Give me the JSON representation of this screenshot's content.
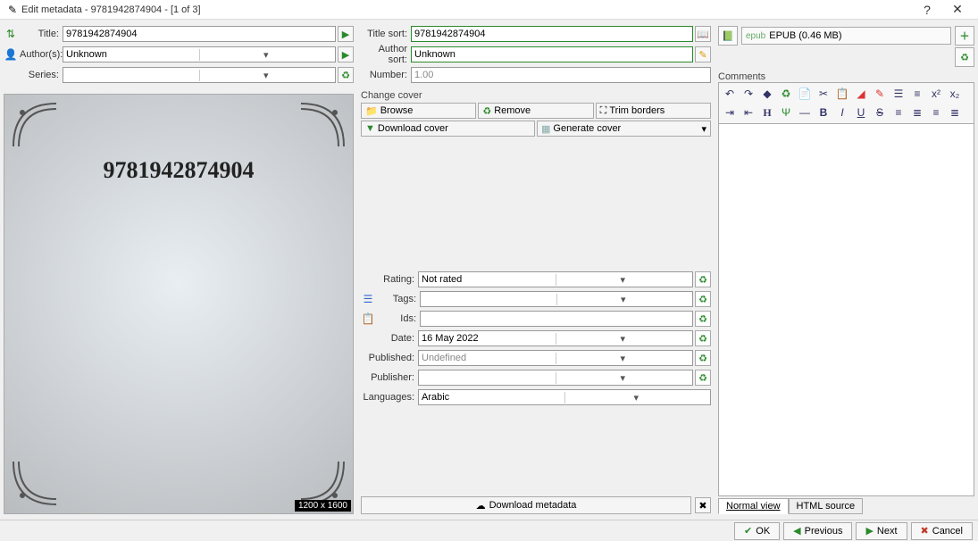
{
  "window": {
    "title": "Edit metadata - 9781942874904 -  [1 of 3]"
  },
  "fields": {
    "title_label": "Title:",
    "title_value": "9781942874904",
    "titlesort_label": "Title sort:",
    "titlesort_value": "9781942874904",
    "authors_label": "Author(s):",
    "authors_value": "Unknown",
    "authorsort_label": "Author sort:",
    "authorsort_value": "Unknown",
    "series_label": "Series:",
    "series_value": "",
    "number_label": "Number:",
    "number_value": "1.00"
  },
  "cover": {
    "section": "Change cover",
    "browse": "Browse",
    "remove": "Remove",
    "trim": "Trim borders",
    "download": "Download cover",
    "generate": "Generate cover",
    "display_text": "9781942874904",
    "dimensions": "1200 x 1600"
  },
  "meta": {
    "rating_label": "Rating:",
    "rating_value": "Not rated",
    "tags_label": "Tags:",
    "tags_value": "",
    "ids_label": "Ids:",
    "ids_value": "",
    "date_label": "Date:",
    "date_value": "16 May 2022",
    "published_label": "Published:",
    "published_value": "Undefined",
    "publisher_label": "Publisher:",
    "publisher_value": "",
    "languages_label": "Languages:",
    "languages_value": "Arabic"
  },
  "download_metadata": "Download metadata",
  "formats": {
    "format": "EPUB (0.46 MB)"
  },
  "comments": {
    "label": "Comments",
    "tab_normal": "Normal view",
    "tab_html": "HTML source"
  },
  "footer": {
    "ok": "OK",
    "prev": "Previous",
    "next": "Next",
    "cancel": "Cancel"
  }
}
